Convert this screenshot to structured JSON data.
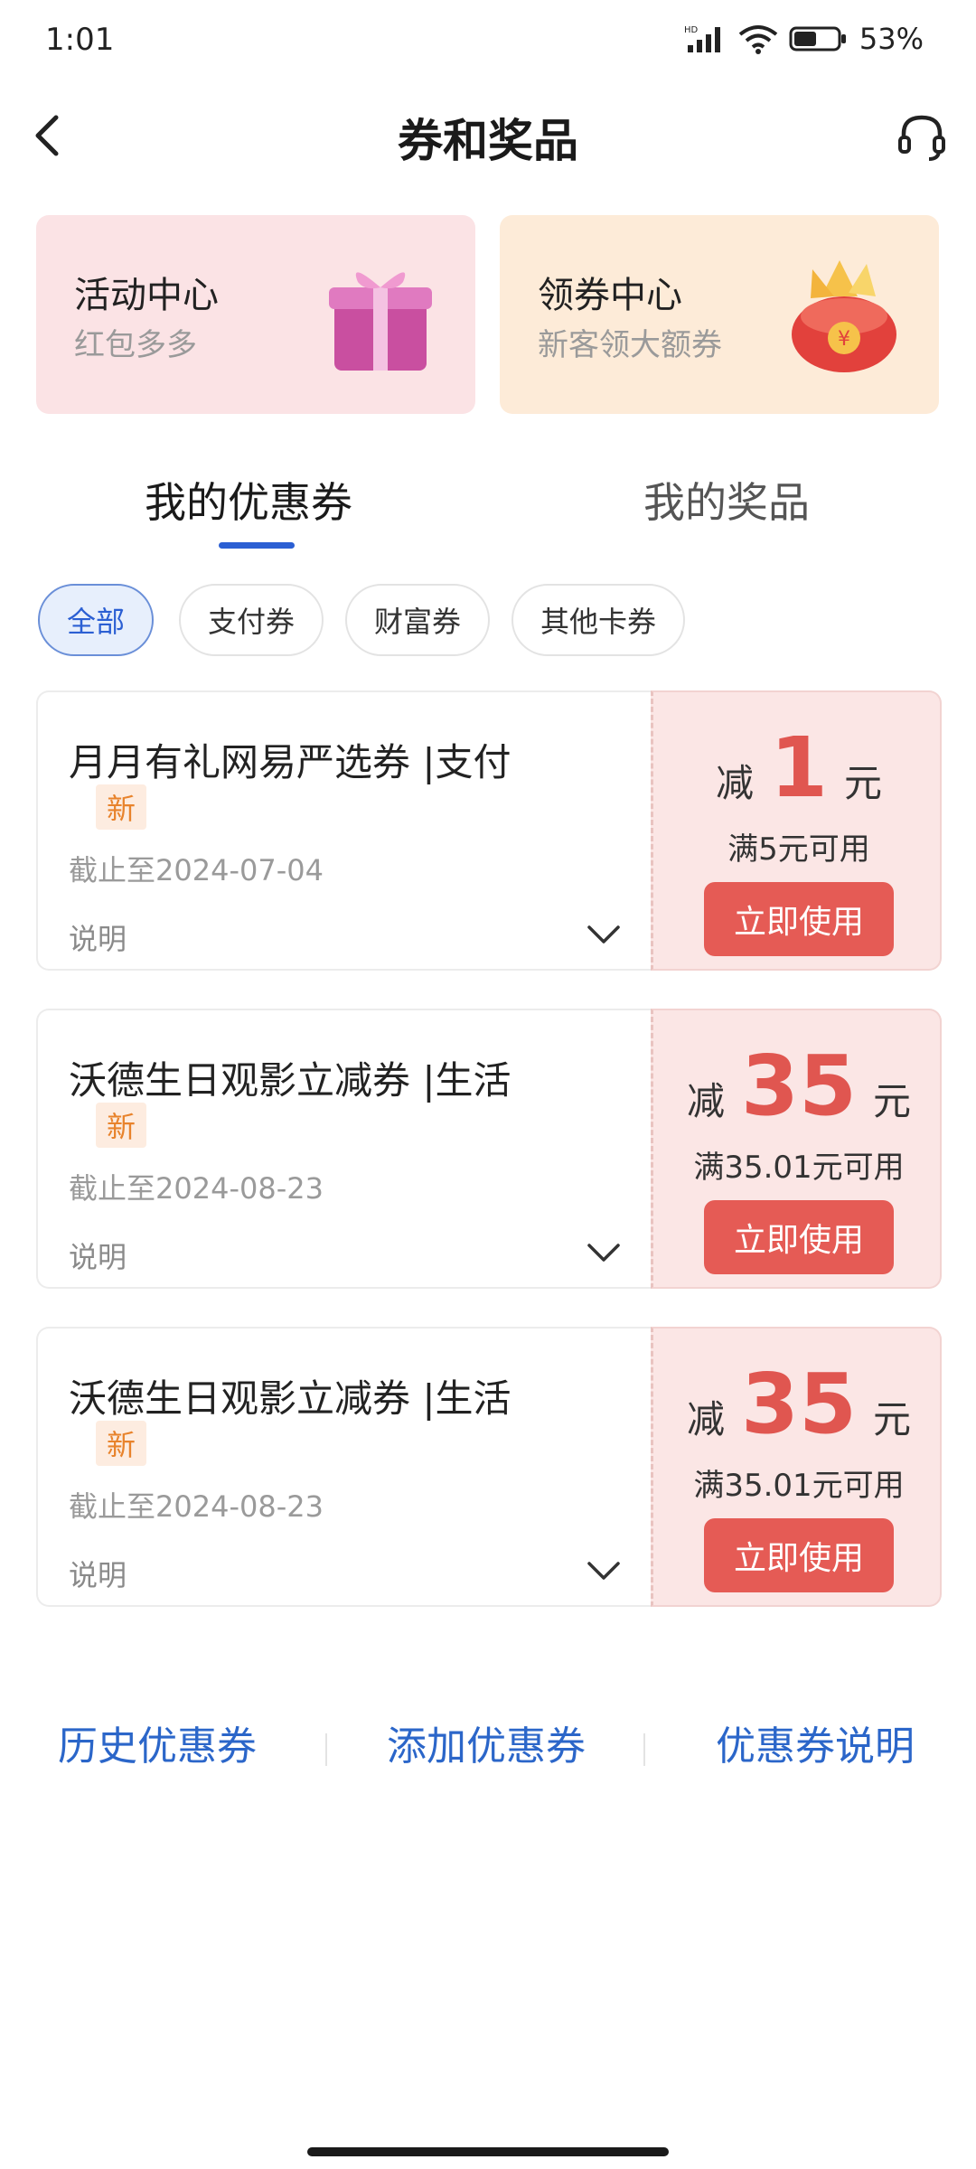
{
  "status_bar": {
    "time": "1:01",
    "battery": "53%"
  },
  "header": {
    "title": "券和奖品",
    "back_icon": "chevron-left-icon",
    "service_icon": "headset-icon"
  },
  "promos": [
    {
      "title": "活动中心",
      "subtitle": "红包多多",
      "icon": "gift-box-icon"
    },
    {
      "title": "领券中心",
      "subtitle": "新客领大额券",
      "icon": "red-envelope-icon"
    }
  ],
  "tabs": [
    {
      "label": "我的优惠券",
      "active": true
    },
    {
      "label": "我的奖品",
      "active": false
    }
  ],
  "filters": [
    {
      "label": "全部",
      "active": true
    },
    {
      "label": "支付券",
      "active": false
    },
    {
      "label": "财富券",
      "active": false
    },
    {
      "label": "其他卡券",
      "active": false
    }
  ],
  "coupons": [
    {
      "title": "月月有礼网易严选券 |支付",
      "badge": "新",
      "expire": "截止至2024-07-04",
      "desc_label": "说明",
      "amount_prefix": "减",
      "amount": "1",
      "amount_unit": "元",
      "condition": "满5元可用",
      "button": "立即使用"
    },
    {
      "title": "沃德生日观影立减券 |生活",
      "badge": "新",
      "expire": "截止至2024-08-23",
      "desc_label": "说明",
      "amount_prefix": "减",
      "amount": "35",
      "amount_unit": "元",
      "condition": "满35.01元可用",
      "button": "立即使用"
    },
    {
      "title": "沃德生日观影立减券 |生活",
      "badge": "新",
      "expire": "截止至2024-08-23",
      "desc_label": "说明",
      "amount_prefix": "减",
      "amount": "35",
      "amount_unit": "元",
      "condition": "满35.01元可用",
      "button": "立即使用"
    }
  ],
  "bottom_links": [
    "历史优惠券",
    "添加优惠券",
    "优惠券说明"
  ],
  "colors": {
    "accent_blue": "#2b5fd3",
    "coupon_red": "#e55b55",
    "badge_orange": "#e8832c"
  }
}
